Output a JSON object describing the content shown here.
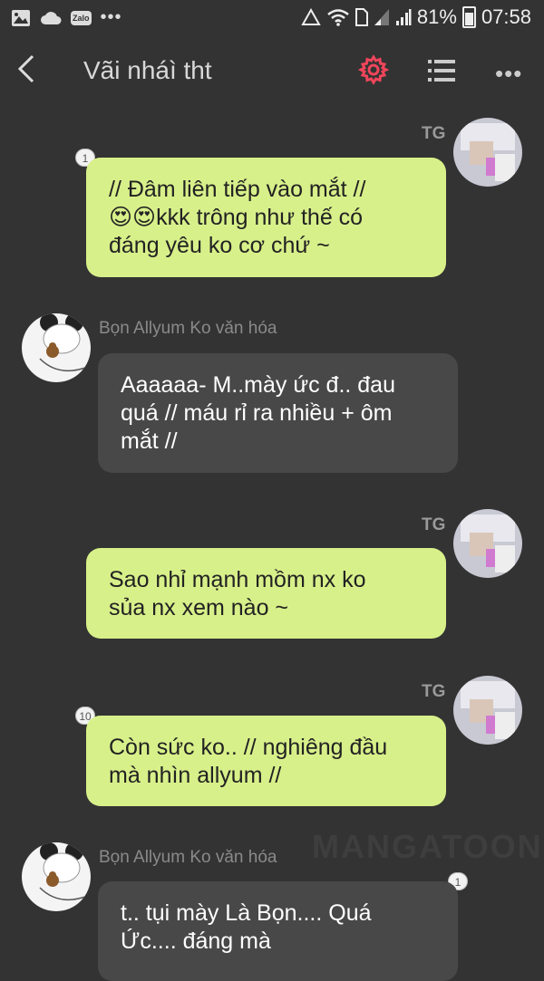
{
  "statusbar": {
    "left_icons": [
      "image-icon",
      "cloud-icon",
      "zalo-icon",
      "more-dots-icon"
    ],
    "zalo_label": "Zalo",
    "dots": "•••",
    "battery": "81%",
    "time": "07:58"
  },
  "toolbar": {
    "title": "Vãi nháì tht",
    "accent": "#f0455b",
    "more": "•••"
  },
  "messages": [
    {
      "side": "out",
      "sender": "TG",
      "badge": "1",
      "lines": [
        "// Đâm liên tiếp vào mắt //",
        "😍😍kkk trông như thế có",
        "đáng yêu ko cơ chứ ~"
      ]
    },
    {
      "side": "in",
      "sender": "Bọn  Allyum Ko văn hóa",
      "lines": [
        "Aaaaaa- M..mày  ức đ.. đau",
        "quá // máu rỉ ra nhiều + ôm",
        "mắt //"
      ]
    },
    {
      "side": "out",
      "sender": "TG",
      "lines": [
        "Sao nhỉ mạnh mồm nx ko",
        "sủa nx xem nào ~"
      ]
    },
    {
      "side": "out",
      "sender": "TG",
      "badge": "10",
      "lines": [
        "Còn sức ko.. // nghiêng đầu",
        "mà nhìn allyum //"
      ]
    },
    {
      "side": "in",
      "sender": "Bọn  Allyum Ko văn hóa",
      "badge": "1",
      "lines": [
        "t.. tụi mày Là Bọn.... Quá",
        "Ức.... đáng mà"
      ]
    }
  ],
  "watermark": "MANGATOON",
  "colors": {
    "background": "#333333",
    "bubble_out": "#d8f08a",
    "bubble_in": "#484848"
  }
}
